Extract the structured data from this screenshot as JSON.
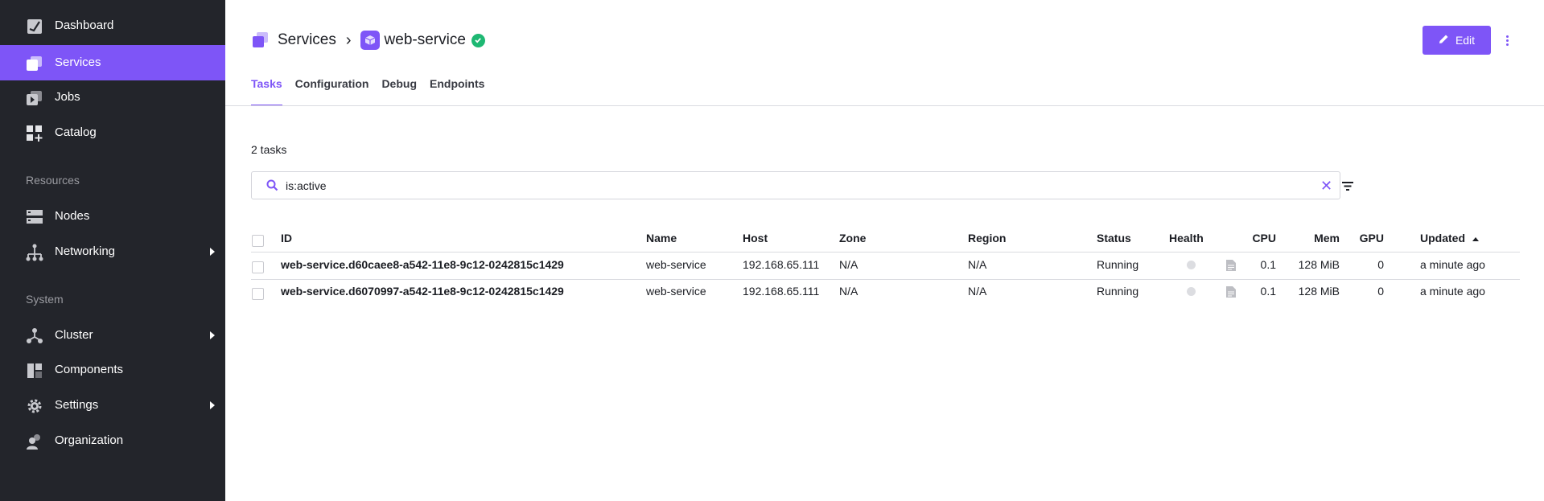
{
  "sidebar": {
    "items": [
      {
        "label": "Dashboard",
        "icon": "dashboard-icon"
      },
      {
        "label": "Services",
        "icon": "services-icon",
        "active": true
      },
      {
        "label": "Jobs",
        "icon": "jobs-icon"
      },
      {
        "label": "Catalog",
        "icon": "catalog-icon"
      }
    ],
    "sections": {
      "resources": {
        "title": "Resources",
        "items": [
          {
            "label": "Nodes",
            "icon": "nodes-icon"
          },
          {
            "label": "Networking",
            "icon": "networking-icon"
          }
        ]
      },
      "system": {
        "title": "System",
        "items": [
          {
            "label": "Cluster",
            "icon": "cluster-icon"
          },
          {
            "label": "Components",
            "icon": "components-icon"
          },
          {
            "label": "Settings",
            "icon": "settings-icon"
          },
          {
            "label": "Organization",
            "icon": "organization-icon"
          }
        ]
      }
    }
  },
  "header": {
    "breadcrumb": {
      "root": "Services",
      "current": "web-service"
    },
    "edit_label": "Edit"
  },
  "tabs": [
    {
      "label": "Tasks",
      "active": true
    },
    {
      "label": "Configuration"
    },
    {
      "label": "Debug"
    },
    {
      "label": "Endpoints"
    }
  ],
  "tasks": {
    "count_label": "2 tasks",
    "search_value": "is:active",
    "columns": {
      "id": "ID",
      "name": "Name",
      "host": "Host",
      "zone": "Zone",
      "region": "Region",
      "status": "Status",
      "health": "Health",
      "cpu": "CPU",
      "mem": "Mem",
      "gpu": "GPU",
      "updated": "Updated"
    },
    "rows": [
      {
        "id": "web-service.d60caee8-a542-11e8-9c12-0242815c1429",
        "name": "web-service",
        "host": "192.168.65.111",
        "zone": "N/A",
        "region": "N/A",
        "status": "Running",
        "cpu": "0.1",
        "mem": "128 MiB",
        "gpu": "0",
        "updated": "a minute ago"
      },
      {
        "id": "web-service.d6070997-a542-11e8-9c12-0242815c1429",
        "name": "web-service",
        "host": "192.168.65.111",
        "zone": "N/A",
        "region": "N/A",
        "status": "Running",
        "cpu": "0.1",
        "mem": "128 MiB",
        "gpu": "0",
        "updated": "a minute ago"
      }
    ]
  },
  "colors": {
    "accent": "#7e55f7",
    "sidebar_bg": "#23252b",
    "success": "#1eb873"
  }
}
